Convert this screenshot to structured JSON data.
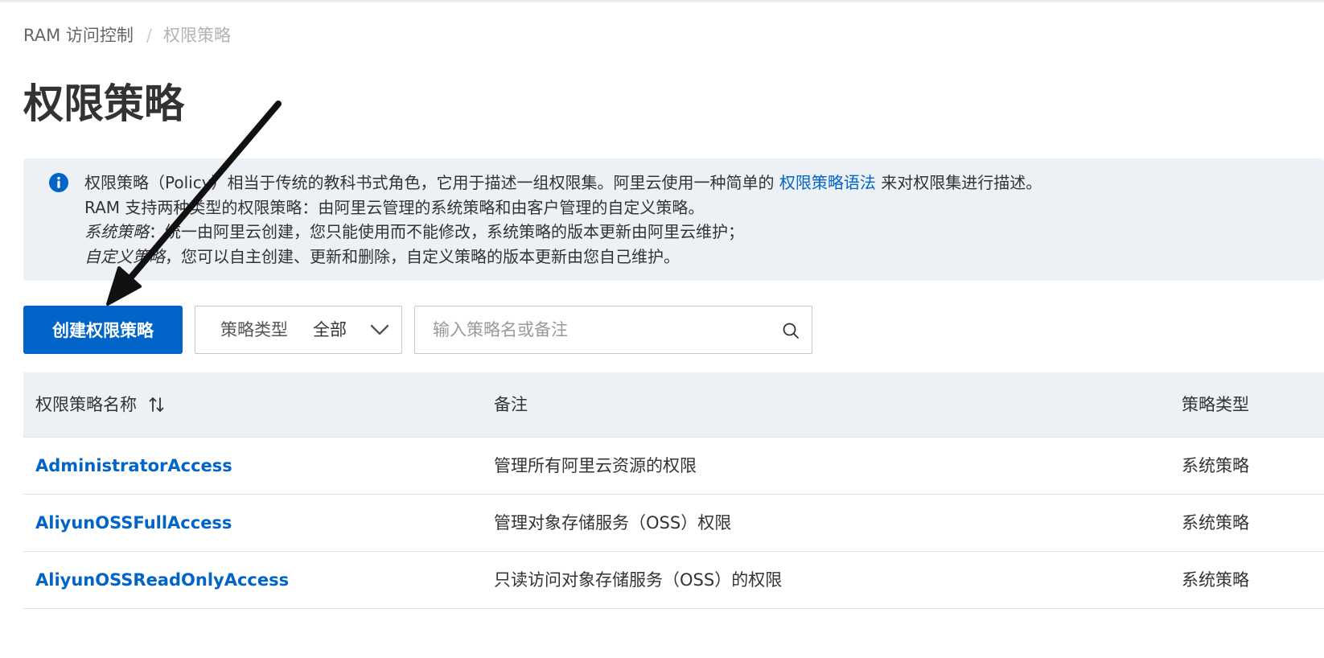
{
  "breadcrumb": {
    "root": "RAM 访问控制",
    "separator": "/",
    "current": "权限策略"
  },
  "page": {
    "title": "权限策略"
  },
  "notice": {
    "icon": "info-icon",
    "line1_pre": "权限策略（Policy）相当于传统的教科书式角色，它用于描述一组权限集。阿里云使用一种简单的 ",
    "line1_link": "权限策略语法",
    "line1_post": " 来对权限集进行描述。",
    "line2": "RAM 支持两种类型的权限策略：由阿里云管理的系统策略和由客户管理的自定义策略。",
    "line3_em": "系统策略",
    "line3_rest": "：统一由阿里云创建，您只能使用而不能修改，系统策略的版本更新由阿里云维护；",
    "line4_em": "自定义策略",
    "line4_rest": "，您可以自主创建、更新和删除，自定义策略的版本更新由您自己维护。"
  },
  "toolbar": {
    "create_label": "创建权限策略",
    "filter_label": "策略类型",
    "filter_value": "全部",
    "search_placeholder": "输入策略名或备注"
  },
  "table": {
    "columns": [
      "权限策略名称",
      "备注",
      "策略类型"
    ],
    "rows": [
      {
        "name": "AdministratorAccess",
        "note": "管理所有阿里云资源的权限",
        "type": "系统策略"
      },
      {
        "name": "AliyunOSSFullAccess",
        "note": "管理对象存储服务（OSS）权限",
        "type": "系统策略"
      },
      {
        "name": "AliyunOSSReadOnlyAccess",
        "note": "只读访问对象存储服务（OSS）的权限",
        "type": "系统策略"
      }
    ]
  },
  "colors": {
    "primary": "#0064c8",
    "notice_bg": "#edf1f6",
    "annotation_arrow": "#111111"
  }
}
